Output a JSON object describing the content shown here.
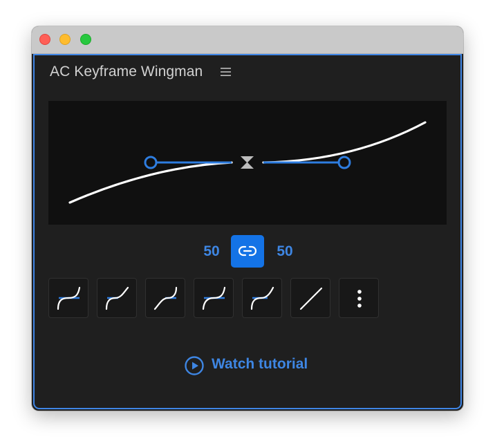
{
  "panel": {
    "title": "AC Keyframe Wingman"
  },
  "icons": {
    "menu": "hamburger-menu-icon",
    "link": "link-icon",
    "keyframe": "hourglass-keyframe-icon",
    "tutorial": "play-circle-icon",
    "more": "vertical-ellipsis-icon"
  },
  "easing": {
    "influence_out": "50",
    "influence_in": "50",
    "linked": true
  },
  "presets": [
    {
      "name": "preset-ease-1"
    },
    {
      "name": "preset-ease-2"
    },
    {
      "name": "preset-ease-3"
    },
    {
      "name": "preset-ease-4"
    },
    {
      "name": "preset-ease-5"
    },
    {
      "name": "preset-linear"
    },
    {
      "name": "preset-more"
    }
  ],
  "tutorial": {
    "label": "Watch tutorial"
  },
  "colors": {
    "accent": "#3e86e3",
    "button": "#1473e6",
    "panel_bg": "#1f1f1f",
    "graph_bg": "#101010",
    "curve": "#ffffff"
  }
}
